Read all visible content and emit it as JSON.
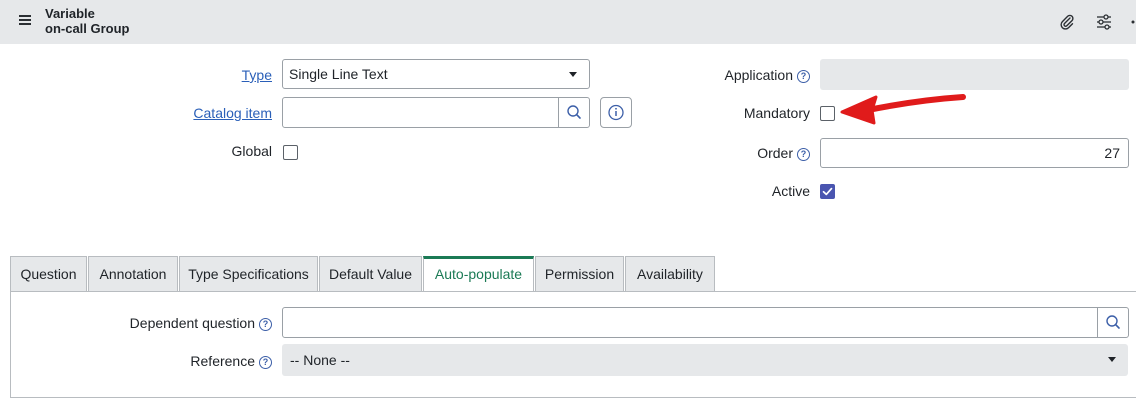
{
  "header": {
    "title_line1": "Variable",
    "title_line2": "on-call Group",
    "icons": [
      "menu-icon",
      "paperclip-icon",
      "settings-sliders-icon",
      "more-icon"
    ]
  },
  "form": {
    "type": {
      "label": "Type",
      "value": "Single Line Text"
    },
    "catalog_item": {
      "label": "Catalog item",
      "value": ""
    },
    "global": {
      "label": "Global",
      "checked": false
    },
    "application": {
      "label": "Application",
      "value": ""
    },
    "mandatory": {
      "label": "Mandatory",
      "checked": false
    },
    "order": {
      "label": "Order",
      "value": "27"
    },
    "active": {
      "label": "Active",
      "checked": true
    }
  },
  "tabs": [
    {
      "label": "Question"
    },
    {
      "label": "Annotation"
    },
    {
      "label": "Type Specifications"
    },
    {
      "label": "Default Value"
    },
    {
      "label": "Auto-populate",
      "active": true
    },
    {
      "label": "Permission"
    },
    {
      "label": "Availability"
    }
  ],
  "autopopulate": {
    "dependent_question": {
      "label": "Dependent question",
      "value": ""
    },
    "reference": {
      "label": "Reference",
      "value": "-- None --"
    }
  },
  "colors": {
    "header_bg": "#e6e8ea",
    "link": "#2a5fb8",
    "active_tab": "#1b7a55",
    "checkbox_checked": "#4a55b0",
    "annotation_arrow": "#e01b1b"
  }
}
